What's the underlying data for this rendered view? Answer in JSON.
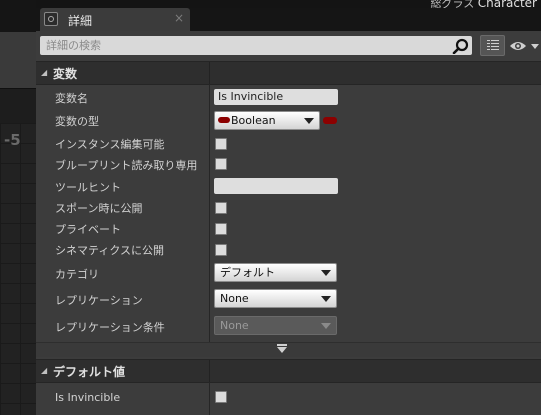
{
  "viewport": {
    "corner_number": "-5"
  },
  "top_strip": {
    "text": "総グラス",
    "class_name": "Character"
  },
  "tab": {
    "label": "詳細",
    "close_glyph": "×",
    "icon": "details-icon"
  },
  "search": {
    "placeholder": "詳細の検索",
    "value": "",
    "icon": "search-icon"
  },
  "toolbar": {
    "view_options_icon": "grid-icon",
    "visibility_icon": "eye-icon"
  },
  "variables_section": {
    "title": "変数",
    "rows": {
      "name": {
        "label": "変数名",
        "value": "Is Invincible"
      },
      "type": {
        "label": "変数の型",
        "value": "Boolean",
        "pin_color": "#8c0000"
      },
      "instance_editable": {
        "label": "インスタンス編集可能",
        "checked": false
      },
      "blueprint_read_only": {
        "label": "ブループリント読み取り専用",
        "checked": false
      },
      "tooltip": {
        "label": "ツールヒント",
        "value": ""
      },
      "expose_on_spawn": {
        "label": "スポーン時に公開",
        "checked": false
      },
      "private": {
        "label": "プライベート",
        "checked": false
      },
      "expose_to_cinematics": {
        "label": "シネマティクスに公開",
        "checked": false
      },
      "category": {
        "label": "カテゴリ",
        "value": "デフォルト"
      },
      "replication": {
        "label": "レプリケーション",
        "value": "None"
      },
      "replication_condition": {
        "label": "レプリケーション条件",
        "value": "None",
        "disabled": true
      }
    }
  },
  "advanced_toggle": {
    "icon": "chevron-down-icon"
  },
  "default_value_section": {
    "title": "デフォルト値",
    "rows": {
      "is_invincible": {
        "label": "Is Invincible",
        "checked": false
      }
    }
  },
  "colors": {
    "panel": "#3c3c3c",
    "header": "#2e2e2e",
    "boolean_pin": "#8c0000"
  }
}
